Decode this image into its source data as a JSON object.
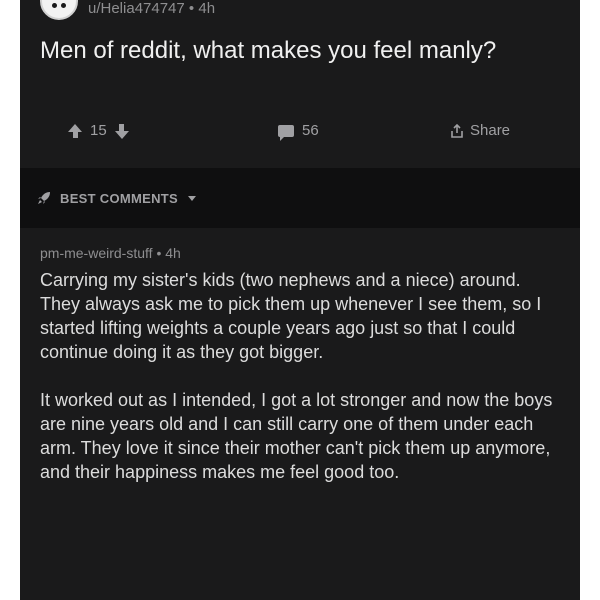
{
  "post": {
    "author": "u/Helia474747",
    "separator": "•",
    "age": "4h",
    "title": "Men of reddit, what makes you feel manly?",
    "score": "15",
    "comment_count": "56",
    "share_label": "Share"
  },
  "sort": {
    "label": "BEST COMMENTS"
  },
  "comment": {
    "author": "pm-me-weird-stuff",
    "separator": "•",
    "age": "4h",
    "paragraphs": [
      "Carrying my sister's kids (two nephews and a niece) around. They always ask me to pick them up whenever I see them, so I started lifting weights a couple years ago just so that I could continue doing it as they got bigger.",
      "It worked out as I intended, I got a lot stronger and now the boys are nine years old and I can still carry one of them under each arm. They love it since their mother can't pick them up anymore, and their happiness makes me feel good too."
    ]
  },
  "colors": {
    "background": "#1a1a1b",
    "sort_bar": "#0f0f10",
    "text_primary": "#f0f0f0",
    "text_secondary": "#8e8e90"
  },
  "icons": {
    "avatar": "snoo-avatar-icon",
    "upvote": "upvote-arrow-icon",
    "downvote": "downvote-arrow-icon",
    "comments": "comment-bubble-icon",
    "share": "share-icon",
    "sort": "rocket-icon"
  }
}
